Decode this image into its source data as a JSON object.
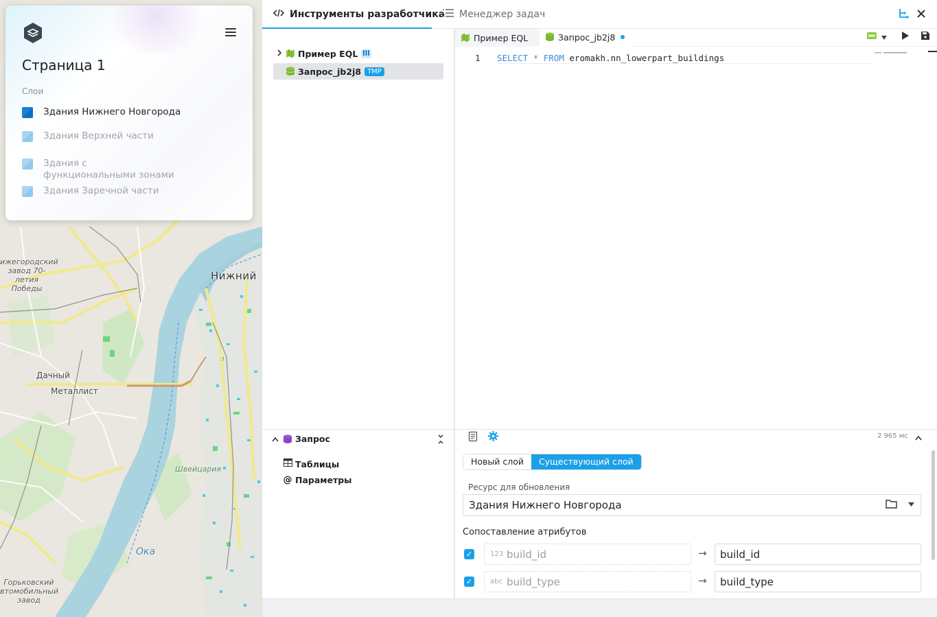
{
  "map": {
    "labels": {
      "nizhny": "Нижний",
      "dachny": "Дачный",
      "metallist": "Металлист",
      "shveitsaria": "Швейцария",
      "oka": "Ока",
      "factory1_l1": "ижегородский",
      "factory1_l2": "завод 70-",
      "factory1_l3": "летия",
      "factory1_l4": "Победы",
      "factory2_l1": "Горьковский",
      "factory2_l2": "втомобильный",
      "factory2_l3": "завод"
    }
  },
  "layer_panel": {
    "page_title": "Страница 1",
    "layers_label": "Слои",
    "layers": [
      {
        "label": "Здания Нижнего Новгорода",
        "color": "#1582d8"
      },
      {
        "label": "Здания Верхней части",
        "color": "#9fd1ef"
      },
      {
        "label": "Здания с функциональными зонами",
        "color": "#9fd1ef"
      },
      {
        "label": "Здания Заречной части",
        "color": "#9fd1ef"
      }
    ]
  },
  "devtools": {
    "tabs": [
      {
        "label": "Инструменты разработчика",
        "icon": "code-icon"
      },
      {
        "label": "Менеджер задач",
        "icon": "list-icon"
      }
    ],
    "tree": [
      {
        "label": "Пример EQL",
        "icon": "map-icon",
        "badge_icon": "columns-icon"
      },
      {
        "label": "Запрос_jb2j8",
        "icon": "database-icon",
        "badge": "TMP"
      }
    ],
    "editor_tabs": [
      {
        "label": "Пример EQL",
        "icon": "map-icon"
      },
      {
        "label": "Запрос_jb2j8",
        "icon": "database-icon"
      }
    ],
    "editor": {
      "line_number": "1",
      "kw_select": "SELECT",
      "op_star": "*",
      "kw_from": "FROM",
      "table": "eromakh.nn_lowerpart_buildings"
    },
    "query_panel": {
      "title": "Запрос",
      "items": [
        {
          "label": "Таблицы",
          "icon": "table-icon"
        },
        {
          "label": "Параметры",
          "icon": "at-icon"
        }
      ]
    },
    "settings": {
      "timing": "2 965 мс",
      "segment_new": "Новый слой",
      "segment_existing": "Существующий слой",
      "resource_label": "Ресурс для обновления",
      "resource_value": "Здания Нижнего Новгорода",
      "mapping_title": "Сопоставление атрибутов",
      "mappings": [
        {
          "type": "123",
          "source": "build_id",
          "target": "build_id"
        },
        {
          "type": "abc",
          "source": "build_type",
          "target": "build_type"
        }
      ]
    }
  },
  "colors": {
    "accent": "#1aa0e8",
    "map_green": "#b8dfa8",
    "map_water": "#a9d3df",
    "map_road_yellow": "#f2ea8a"
  }
}
